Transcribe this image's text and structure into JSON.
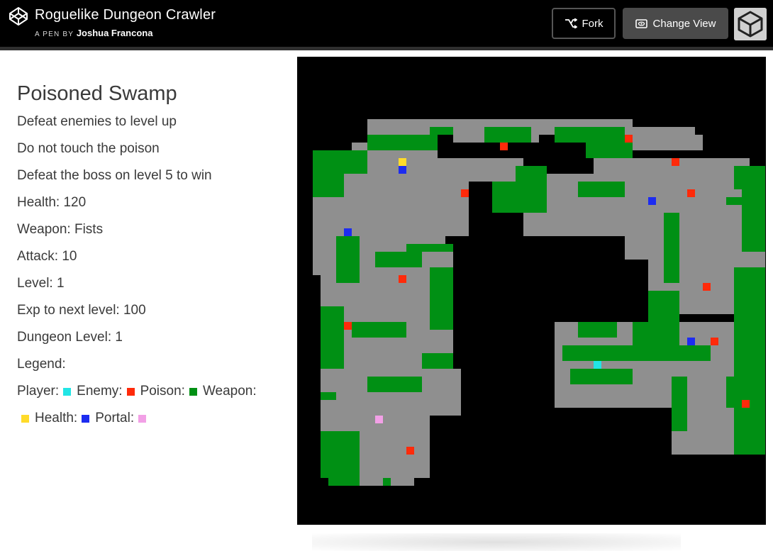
{
  "header": {
    "title": "Roguelike Dungeon Crawler",
    "byline_prefix": "A PEN BY",
    "author": "Joshua Francona",
    "fork_label": "Fork",
    "change_view_label": "Change View"
  },
  "game": {
    "dungeon_name": "Poisoned Swamp",
    "instructions": [
      "Defeat enemies to level up",
      "Do not touch the poison",
      "Defeat the boss on level 5 to win"
    ],
    "stats": {
      "health": "Health: 120",
      "weapon": "Weapon: Fists",
      "attack": "Attack: 10",
      "level": "Level: 1",
      "exp": "Exp to next level: 100",
      "dungeon_level": "Dungeon Level: 1"
    },
    "legend_title": "Legend:",
    "legend": {
      "player": "Player:",
      "enemy": "Enemy:",
      "poison": "Poison:",
      "weapon": "Weapon:",
      "health": "Health:",
      "portal": "Portal:"
    }
  },
  "colors": {
    "player": "#22e5e5",
    "enemy": "#ff2a0a",
    "poison": "#009014",
    "weapon": "#ffdb2a",
    "health": "#1d2cf0",
    "portal": "#f2a0e6",
    "floor": "#8f8f8f",
    "wall": "#000000"
  }
}
